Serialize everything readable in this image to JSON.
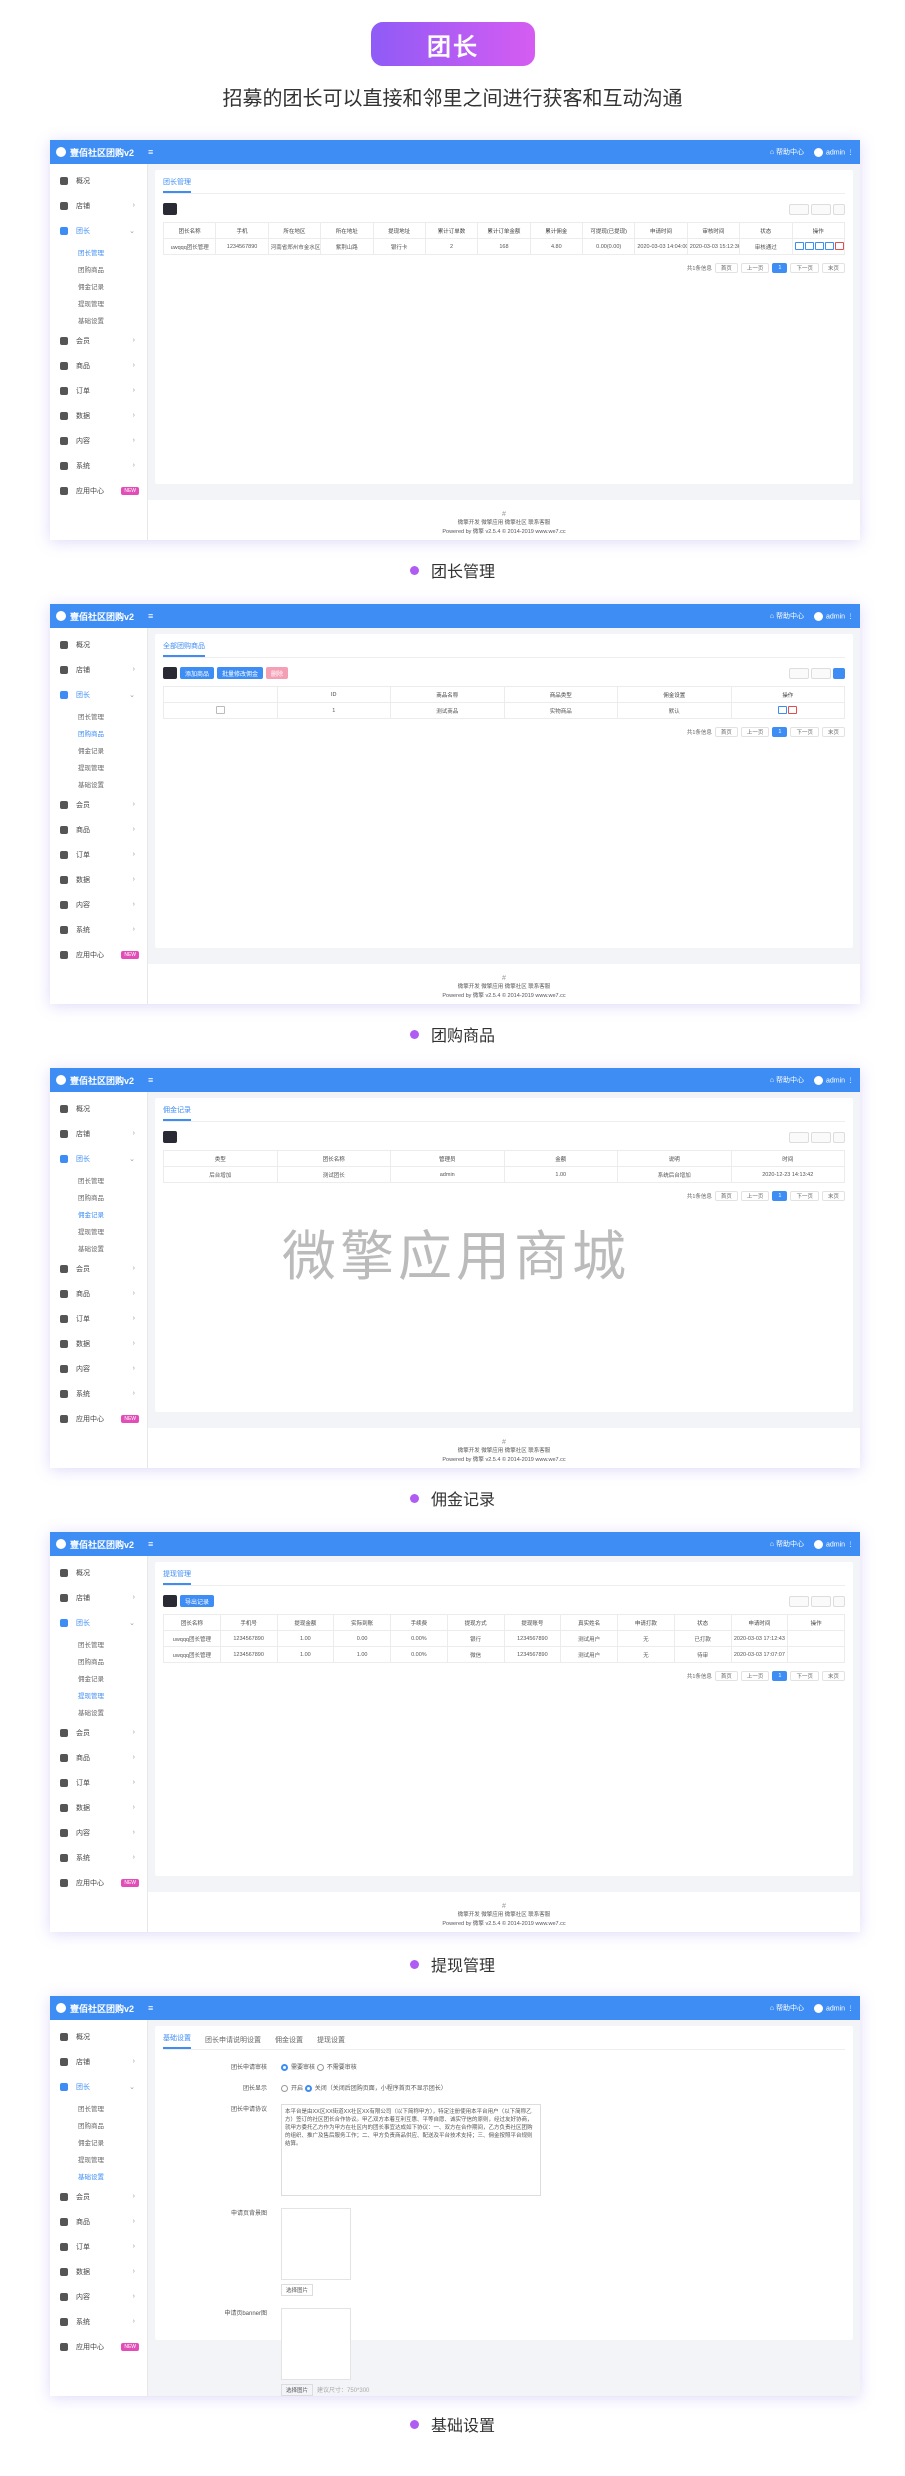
{
  "hero": {
    "badge": "团长",
    "subtitle": "招募的团长可以直接和邻里之间进行获客和互动沟通"
  },
  "app": {
    "name": "壹佰社区团购v2",
    "menu_toggle": "≡",
    "help_label": "帮助中心",
    "user": "admin"
  },
  "sidebar": {
    "items": [
      {
        "label": "概况"
      },
      {
        "label": "店铺"
      },
      {
        "label": "团长"
      },
      {
        "label": "会员"
      },
      {
        "label": "商品"
      },
      {
        "label": "订单"
      },
      {
        "label": "数据"
      },
      {
        "label": "内容"
      },
      {
        "label": "系统"
      },
      {
        "label": "应用中心",
        "badge": "NEW"
      }
    ],
    "sub_items": [
      "团长管理",
      "团购商品",
      "佣金记录",
      "提现管理",
      "基础设置"
    ]
  },
  "footer": {
    "line1": "微擎开发 微擎应用 微擎社区 联系客服",
    "line2": "Powered by 微擎 v2.5.4 © 2014-2019 www.we7.cc"
  },
  "pager": {
    "info": "共1条信息",
    "first": "首页",
    "prev": "上一页",
    "page": "1",
    "next": "下一页",
    "last": "末页"
  },
  "screens": [
    {
      "caption": "团长管理",
      "tab": "团长管理",
      "headers": [
        "团长名称",
        "手机",
        "所在地区",
        "所在地址",
        "提现地址",
        "累计订单数",
        "累计订单金额",
        "累计佣金",
        "可提现(已提现)",
        "申请时间",
        "审核时间",
        "状态",
        "操作"
      ],
      "rows": [
        [
          "uwqqq团长管理",
          "1234567890",
          "河南省郑州市金水区",
          "紫荆山路",
          "银行卡",
          "2",
          "168",
          "4.80",
          "0.00(0.00)",
          "2020-03-03 14:04:00",
          "2020-03-03 15:12:36",
          "审核通过",
          ""
        ]
      ]
    },
    {
      "caption": "团购商品",
      "tab": "全部团购商品",
      "buttons": [
        "添加商品",
        "批量修改佣金",
        "删除"
      ],
      "headers": [
        "",
        "ID",
        "商品名称",
        "商品类型",
        "佣金设置",
        "操作"
      ],
      "rows": [
        [
          "",
          "1",
          "测试商品",
          "实物商品",
          "默认",
          ""
        ]
      ]
    },
    {
      "caption": "佣金记录",
      "tab": "佣金记录",
      "watermark": "微擎应用商城",
      "headers": [
        "类型",
        "团长名称",
        "管理员",
        "金额",
        "说明",
        "时间"
      ],
      "rows": [
        [
          "后台增加",
          "测试团长",
          "admin",
          "1.00",
          "系统后台增加",
          "2020-12-23 14:13:42"
        ]
      ]
    },
    {
      "caption": "提现管理",
      "tab": "提现管理",
      "buttons": [
        "导出记录"
      ],
      "headers": [
        "团长名称",
        "手机号",
        "提现金额",
        "实际到账",
        "手续费",
        "提现方式",
        "提现账号",
        "真实姓名",
        "申请打款",
        "状态",
        "申请时间",
        "操作"
      ],
      "rows": [
        [
          "uwqqq团长管理",
          "1234567890",
          "1.00",
          "0.00",
          "0.00%",
          "银行",
          "1234567890",
          "测试用户",
          "无",
          "已打款",
          "2020-03-03 17:12:43",
          ""
        ],
        [
          "uwqqq团长管理",
          "1234567890",
          "1.00",
          "1.00",
          "0.00%",
          "微信",
          "1234567890",
          "测试用户",
          "无",
          "待审",
          "2020-03-03 17:07:07",
          ""
        ]
      ]
    },
    {
      "caption": "基础设置",
      "tabs": [
        "基础设置",
        "团长申请说明设置",
        "佣金设置",
        "提现设置"
      ],
      "form": {
        "apply_label": "团长申请审核",
        "apply_opt1": "需要审核",
        "apply_opt2": "不需要审核",
        "show_label": "团长显示",
        "show_opt1": "开启",
        "show_opt2": "关闭（关闭后团购页面，小程序首页不显示团长）",
        "agreement_label": "团长申请协议",
        "agreement_text": "本平台是由XX区XX街道XX社区XX有限公司（以下简称甲方），特定注册使用本平台用户（以下简称乙方）签订的社区团长合作协议。甲乙双方本着互利互惠、平等自愿、诚实守信的原则，经过友好协商，就甲方委托乙方作为甲方在社区内的团长事宜达成如下协议：一、双方在合作期间，乙方负责社区团购的组织、推广及售后服务工作；二、甲方负责商品供应、配送及平台技术支持；三、佣金按照平台规则结算。",
        "bg_label": "申请页背景图",
        "bg_btn": "选择图片",
        "banner_label": "申请页banner图",
        "banner_btn": "选择图片",
        "banner_hint": "建议尺寸：750*300"
      }
    }
  ]
}
